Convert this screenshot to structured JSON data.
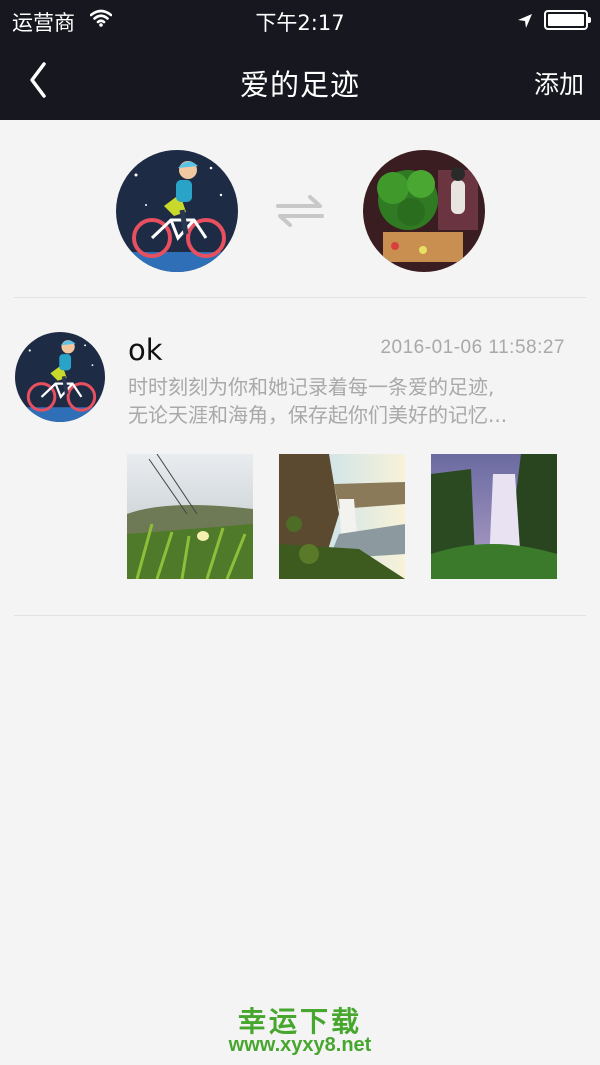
{
  "status_bar": {
    "carrier": "运营商",
    "time": "下午2:17",
    "wifi_icon": "wifi-icon",
    "location_icon": "location-arrow-icon",
    "battery_icon": "battery-icon"
  },
  "nav": {
    "back_icon": "chevron-left-icon",
    "title": "爱的足迹",
    "add_label": "添加"
  },
  "couple": {
    "swap_icon": "swap-arrows-icon"
  },
  "post": {
    "name": "ok",
    "timestamp": "2016-01-06 11:58:27",
    "text_line1": "时时刻刻为你和她记录着每一条爱的足迹,",
    "text_line2": "无论天涯和海角，保存起你们美好的记忆..."
  },
  "watermark": {
    "line1": "幸运下载",
    "line2": "www.xyxy8.net"
  },
  "colors": {
    "nav_background": "#16171f",
    "page_background": "#f4f4f4",
    "secondary_text": "#a9a9a9",
    "watermark_green": "#47a62d"
  }
}
